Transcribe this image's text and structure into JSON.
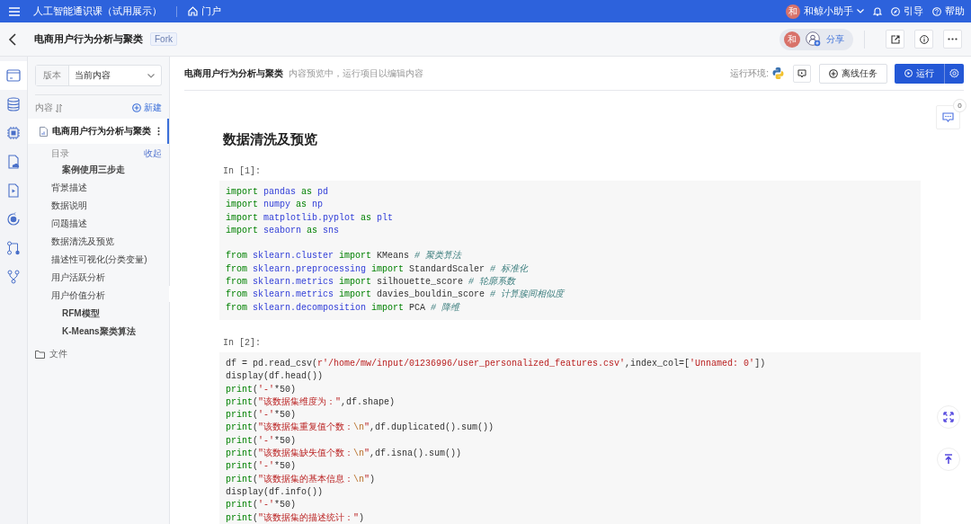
{
  "topbar": {
    "course": "人工智能通识课（试用展示）",
    "portal": "门户",
    "user_avatar": "和",
    "user": "和鲸小助手",
    "guide": "引导",
    "help": "帮助"
  },
  "subbar": {
    "title": "电商用户行为分析与聚类",
    "tag": "Fork",
    "avatar": "和",
    "share": "分享"
  },
  "rail": [
    {
      "selected": true
    },
    {
      "selected": false
    },
    {
      "selected": false
    },
    {
      "selected": false
    },
    {
      "selected": false
    },
    {
      "selected": false
    },
    {
      "selected": false
    },
    {
      "selected": false
    }
  ],
  "sidebar": {
    "version_label": "版本",
    "version_value": "当前内容",
    "content_label": "内容",
    "new": "新建",
    "document": {
      "name": "电商用户行为分析与聚类",
      "selected": true
    },
    "toc": {
      "title": "目录",
      "collapse": "收起",
      "children": [
        {
          "text": "案例使用三步走"
        }
      ]
    },
    "toc_items": [
      {
        "text": "背景描述"
      },
      {
        "text": "数据说明"
      },
      {
        "text": "问题描述"
      },
      {
        "text": "数据清洗及预览"
      },
      {
        "text": "描述性可视化(分类变量)"
      },
      {
        "text": "用户活跃分析"
      },
      {
        "text": "用户价值分析",
        "children": [
          {
            "text": "RFM模型"
          },
          {
            "text": "K-Means聚类算法"
          }
        ]
      }
    ],
    "files": "文件"
  },
  "header": {
    "title": "电商用户行为分析与聚类",
    "hint": "内容预览中，运行项目以编辑内容",
    "env_label": "运行环境:",
    "offline": "离线任务",
    "run": "运行"
  },
  "comments": {
    "count": "0"
  },
  "notebook": {
    "heading": "数据清洗及预览",
    "cells": [
      {
        "prompt": "In [1]:",
        "blocks": [
          [
            [
              {
                "kind": "kw",
                "text": "import "
              },
              {
                "kind": "mod",
                "text": "pandas "
              },
              {
                "kind": "kw",
                "text": "as "
              },
              {
                "kind": "mod",
                "text": "pd"
              }
            ],
            [
              {
                "kind": "kw",
                "text": "import "
              },
              {
                "kind": "mod",
                "text": "numpy "
              },
              {
                "kind": "kw",
                "text": "as "
              },
              {
                "kind": "mod",
                "text": "np"
              }
            ],
            [
              {
                "kind": "kw",
                "text": "import "
              },
              {
                "kind": "mod",
                "text": "matplotlib.pyplot "
              },
              {
                "kind": "kw",
                "text": "as "
              },
              {
                "kind": "mod",
                "text": "plt"
              }
            ],
            [
              {
                "kind": "kw",
                "text": "import "
              },
              {
                "kind": "mod",
                "text": "seaborn "
              },
              {
                "kind": "kw",
                "text": "as "
              },
              {
                "kind": "mod",
                "text": "sns"
              }
            ]
          ],
          [
            [
              {
                "kind": "kw",
                "text": "from "
              },
              {
                "kind": "mod",
                "text": "sklearn.cluster "
              },
              {
                "kind": "kw",
                "text": "import "
              },
              {
                "kind": "plain",
                "text": "KMeans "
              },
              {
                "kind": "cmt",
                "text": "# 聚类算法"
              }
            ],
            [
              {
                "kind": "kw",
                "text": "from "
              },
              {
                "kind": "mod",
                "text": "sklearn.preprocessing "
              },
              {
                "kind": "kw",
                "text": "import "
              },
              {
                "kind": "plain",
                "text": "StandardScaler "
              },
              {
                "kind": "cmt",
                "text": "# 标准化"
              }
            ],
            [
              {
                "kind": "kw",
                "text": "from "
              },
              {
                "kind": "mod",
                "text": "sklearn.metrics "
              },
              {
                "kind": "kw",
                "text": "import "
              },
              {
                "kind": "plain",
                "text": "silhouette_score "
              },
              {
                "kind": "cmt",
                "text": "# 轮廓系数"
              }
            ],
            [
              {
                "kind": "kw",
                "text": "from "
              },
              {
                "kind": "mod",
                "text": "sklearn.metrics "
              },
              {
                "kind": "kw",
                "text": "import "
              },
              {
                "kind": "plain",
                "text": "davies_bouldin_score "
              },
              {
                "kind": "cmt",
                "text": "# 计算簇间相似度"
              }
            ],
            [
              {
                "kind": "kw",
                "text": "from "
              },
              {
                "kind": "mod",
                "text": "sklearn.decomposition "
              },
              {
                "kind": "kw",
                "text": "import "
              },
              {
                "kind": "plain",
                "text": "PCA "
              },
              {
                "kind": "cmt",
                "text": "# 降维"
              }
            ]
          ]
        ]
      },
      {
        "prompt": "In [2]:",
        "blocks": [
          [
            [
              {
                "kind": "plain",
                "text": "df = pd.read_csv("
              },
              {
                "kind": "str",
                "text": "r'/home/mw/input/01236996/user_personalized_features.csv'"
              },
              {
                "kind": "plain",
                "text": ",index_col=["
              },
              {
                "kind": "str",
                "text": "'Unnamed: 0'"
              },
              {
                "kind": "plain",
                "text": "])"
              }
            ],
            [
              {
                "kind": "plain",
                "text": "display(df.head())"
              }
            ],
            [
              {
                "kind": "kw",
                "text": "print"
              },
              {
                "kind": "plain",
                "text": "("
              },
              {
                "kind": "str",
                "text": "'-'"
              },
              {
                "kind": "plain",
                "text": "*50)"
              }
            ],
            [
              {
                "kind": "kw",
                "text": "print"
              },
              {
                "kind": "plain",
                "text": "("
              },
              {
                "kind": "str",
                "text": "\"该数据集维度为：\""
              },
              {
                "kind": "plain",
                "text": ",df.shape)"
              }
            ],
            [
              {
                "kind": "kw",
                "text": "print"
              },
              {
                "kind": "plain",
                "text": "("
              },
              {
                "kind": "str",
                "text": "'-'"
              },
              {
                "kind": "plain",
                "text": "*50)"
              }
            ],
            [
              {
                "kind": "kw",
                "text": "print"
              },
              {
                "kind": "plain",
                "text": "("
              },
              {
                "kind": "str",
                "text": "\"该数据集重复值个数："
              },
              {
                "kind": "esc",
                "text": "\\n"
              },
              {
                "kind": "str",
                "text": "\""
              },
              {
                "kind": "plain",
                "text": ",df.duplicated().sum())"
              }
            ],
            [
              {
                "kind": "kw",
                "text": "print"
              },
              {
                "kind": "plain",
                "text": "("
              },
              {
                "kind": "str",
                "text": "'-'"
              },
              {
                "kind": "plain",
                "text": "*50)"
              }
            ],
            [
              {
                "kind": "kw",
                "text": "print"
              },
              {
                "kind": "plain",
                "text": "("
              },
              {
                "kind": "str",
                "text": "\"该数据集缺失值个数："
              },
              {
                "kind": "esc",
                "text": "\\n"
              },
              {
                "kind": "str",
                "text": "\""
              },
              {
                "kind": "plain",
                "text": ",df.isna().sum())"
              }
            ],
            [
              {
                "kind": "kw",
                "text": "print"
              },
              {
                "kind": "plain",
                "text": "("
              },
              {
                "kind": "str",
                "text": "'-'"
              },
              {
                "kind": "plain",
                "text": "*50)"
              }
            ],
            [
              {
                "kind": "kw",
                "text": "print"
              },
              {
                "kind": "plain",
                "text": "("
              },
              {
                "kind": "str",
                "text": "\"该数据集的基本信息："
              },
              {
                "kind": "esc",
                "text": "\\n"
              },
              {
                "kind": "str",
                "text": "\""
              },
              {
                "kind": "plain",
                "text": ")"
              }
            ],
            [
              {
                "kind": "plain",
                "text": "display(df.info())"
              }
            ],
            [
              {
                "kind": "kw",
                "text": "print"
              },
              {
                "kind": "plain",
                "text": "("
              },
              {
                "kind": "str",
                "text": "'-'"
              },
              {
                "kind": "plain",
                "text": "*50)"
              }
            ],
            [
              {
                "kind": "kw",
                "text": "print"
              },
              {
                "kind": "plain",
                "text": "("
              },
              {
                "kind": "str",
                "text": "\"该数据集的描述统计：\""
              },
              {
                "kind": "plain",
                "text": ")"
              }
            ]
          ]
        ]
      }
    ]
  }
}
